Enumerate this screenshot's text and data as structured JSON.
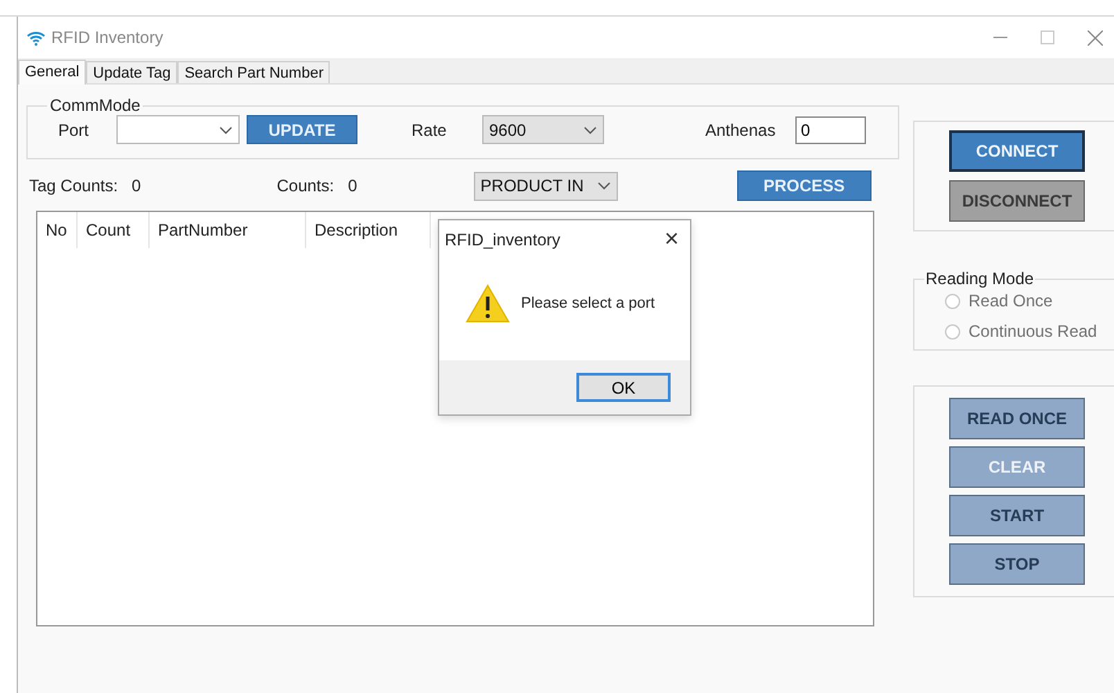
{
  "window": {
    "title": "RFID Inventory"
  },
  "tabs": [
    {
      "label": "General",
      "selected": true
    },
    {
      "label": "Update Tag",
      "selected": false
    },
    {
      "label": "Search Part Number",
      "selected": false
    }
  ],
  "comm_mode": {
    "title": "CommMode",
    "port_label": "Port",
    "update_button": "UPDATE",
    "rate_label": "Rate",
    "rate_value": "9600",
    "antennas_label": "Anthenas",
    "antennas_value": "0"
  },
  "counts": {
    "tag_counts_label": "Tag Counts:",
    "tag_counts_value": "0",
    "counts_label": "Counts:",
    "counts_value": "0",
    "mode_value": "PRODUCT IN",
    "process_button": "PROCESS"
  },
  "table": {
    "columns": [
      "No",
      "Count",
      "PartNumber",
      "Description"
    ]
  },
  "connection_buttons": [
    {
      "label": "CONNECT",
      "kind": "primary"
    },
    {
      "label": "DISCONNECT",
      "kind": "gray"
    }
  ],
  "reading_mode": {
    "title": "Reading Mode",
    "options": [
      {
        "label": "Read Once",
        "selected": false,
        "disabled": true
      },
      {
        "label": "Continuous Read",
        "selected": false,
        "disabled": true
      }
    ]
  },
  "action_buttons": [
    {
      "label": "READ ONCE",
      "disabled": false
    },
    {
      "label": "CLEAR",
      "disabled": true
    },
    {
      "label": "START",
      "disabled": false
    },
    {
      "label": "STOP",
      "disabled": false
    }
  ],
  "dialog": {
    "title": "RFID_inventory",
    "close": "×",
    "message": "Please select a port",
    "button": "OK"
  }
}
